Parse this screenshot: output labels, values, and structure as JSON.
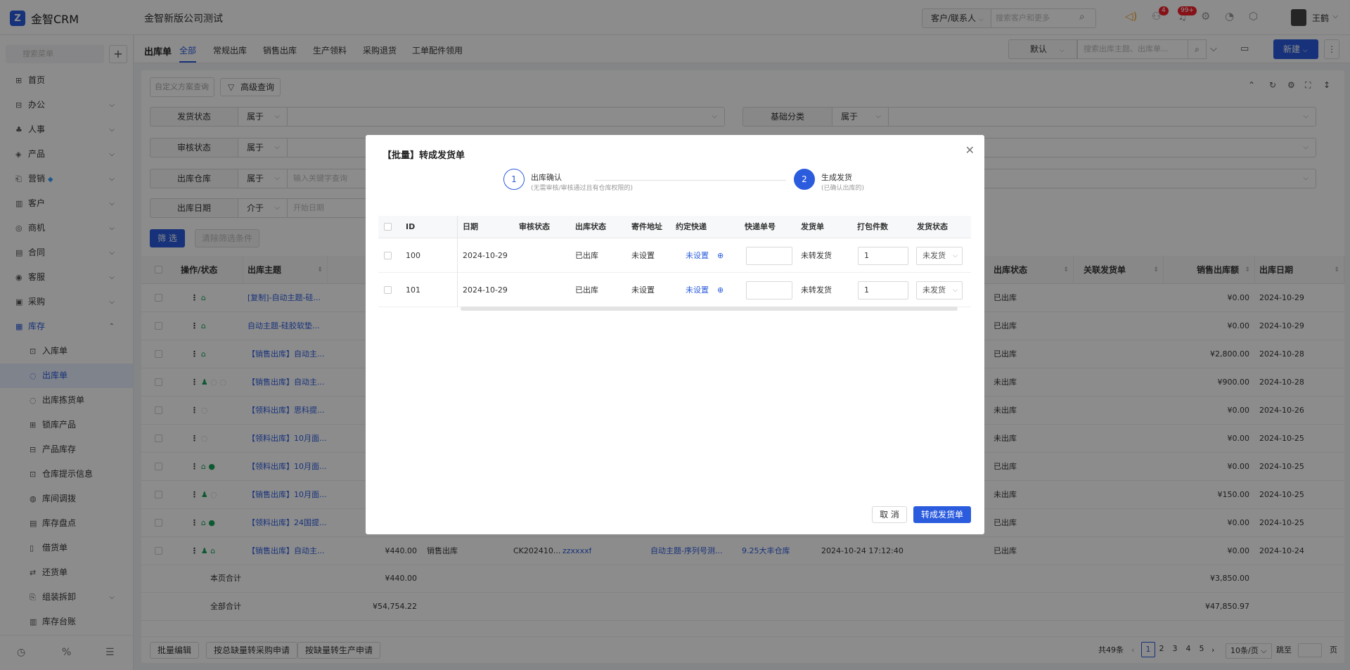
{
  "app": {
    "logo_mark": "Z",
    "logo_text": "金智CRM",
    "company": "金智新版公司测试"
  },
  "topbar": {
    "search_type": "客户/联系人",
    "search_placeholder": "搜索客户和更多",
    "notif_badge_1": "4",
    "notif_badge_2": "99+",
    "user_name": "王鹤"
  },
  "sidebar": {
    "search_placeholder": "搜索菜单",
    "add_label": "+",
    "items": [
      {
        "label": "首页",
        "icon": "home-icon"
      },
      {
        "label": "办公",
        "icon": "office-icon"
      },
      {
        "label": "人事",
        "icon": "hr-icon"
      },
      {
        "label": "产品",
        "icon": "product-icon"
      },
      {
        "label": "营销",
        "icon": "marketing-icon"
      },
      {
        "label": "客户",
        "icon": "customer-icon"
      },
      {
        "label": "商机",
        "icon": "opportunity-icon"
      },
      {
        "label": "合同",
        "icon": "contract-icon"
      },
      {
        "label": "客服",
        "icon": "service-icon"
      },
      {
        "label": "采购",
        "icon": "purchase-icon"
      },
      {
        "label": "库存",
        "icon": "inventory-icon"
      }
    ],
    "sub_items": [
      {
        "label": "入库单"
      },
      {
        "label": "出库单"
      },
      {
        "label": "出库拣货单"
      },
      {
        "label": "锁库产品"
      },
      {
        "label": "产品库存"
      },
      {
        "label": "仓库提示信息"
      },
      {
        "label": "库间调拨"
      },
      {
        "label": "库存盘点"
      },
      {
        "label": "借货单"
      },
      {
        "label": "还货单"
      },
      {
        "label": "组装拆卸"
      },
      {
        "label": "库存台账"
      }
    ]
  },
  "subbar": {
    "title": "出库单",
    "tabs": [
      "全部",
      "常规出库",
      "销售出库",
      "生产领料",
      "采购退货",
      "工单配件领用"
    ],
    "view": "默认",
    "search_placeholder": "搜索出库主题、出库单...",
    "new_label": "新建"
  },
  "filters": {
    "custom_query": "自定义方案查询",
    "advanced": "高级查询",
    "rows": [
      {
        "label": "发货状态",
        "op": "属于",
        "value": ""
      },
      {
        "label": "审核状态",
        "op": "属于",
        "value": ""
      },
      {
        "label": "出库仓库",
        "op": "属于",
        "value": "输入关键字查询"
      },
      {
        "label": "出库日期",
        "op": "介于",
        "value": "开始日期"
      }
    ],
    "extra": {
      "label": "基础分类",
      "op": "属于"
    },
    "filter_btn": "筛 选",
    "clear_btn": "清除筛选条件"
  },
  "grid": {
    "headers": {
      "ops": "操作/状态",
      "subject": "出库主题",
      "out_status": "出库状态",
      "linked": "关联发货单",
      "sale_amount": "销售出库额",
      "out_date": "出库日期"
    },
    "rows": [
      {
        "subject": "[复制]-自动主题-硅...",
        "status": "已出库",
        "amount": "¥0.00",
        "date": "2024-10-29"
      },
      {
        "subject": "自动主题-硅胶软垫...",
        "status": "已出库",
        "amount": "¥0.00",
        "date": "2024-10-29"
      },
      {
        "subject": "【销售出库】自动主...",
        "status": "已出库",
        "amount": "¥2,800.00",
        "date": "2024-10-28"
      },
      {
        "subject": "【销售出库】自动主...",
        "status": "未出库",
        "amount": "¥900.00",
        "date": "2024-10-28"
      },
      {
        "subject": "【领料出库】思科提...",
        "status": "未出库",
        "amount": "¥0.00",
        "date": "2024-10-26"
      },
      {
        "subject": "【领料出库】10月面...",
        "status": "未出库",
        "amount": "¥0.00",
        "date": "2024-10-25"
      },
      {
        "subject": "【领料出库】10月面...",
        "status": "已出库",
        "amount": "¥0.00",
        "date": "2024-10-25"
      },
      {
        "subject": "【销售出库】10月面...",
        "status": "未出库",
        "amount": "¥150.00",
        "date": "2024-10-25"
      },
      {
        "subject": "【领料出库】24国提...",
        "status": "已出库",
        "amount": "¥0.00",
        "date": "2024-10-25"
      },
      {
        "subject": "【销售出库】自动主...",
        "status": "已出库",
        "amount": "¥0.00",
        "date": "2024-10-24"
      }
    ],
    "last_row_extra": {
      "total": "¥440.00",
      "type": "销售出库",
      "code": "CK202410...",
      "customer": "zzxxxxf",
      "subject2": "自动主题-序列号测...",
      "warehouse": "9.25大丰仓库",
      "time": "2024-10-24 17:12:40"
    },
    "page_total_label": "本页合计",
    "page_total_value": "¥440.00",
    "page_total_sale": "¥3,850.00",
    "all_total_label": "全部合计",
    "all_total_value": "¥54,754.22",
    "all_total_sale": "¥47,850.97"
  },
  "footer": {
    "batch_edit": "批量编辑",
    "to_purchase": "按总缺量转采购申请",
    "to_production": "按缺量转生产申请",
    "total": "共49条",
    "pages": [
      "1",
      "2",
      "3",
      "4",
      "5"
    ],
    "page_size": "10条/页",
    "goto": "跳至",
    "page_unit": "页"
  },
  "modal": {
    "title": "【批量】转成发货单",
    "step1_num": "1",
    "step1_title": "出库确认",
    "step1_desc": "(无需审核/审核通过且有仓库权限的)",
    "step2_num": "2",
    "step2_title": "生成发货",
    "step2_desc": "(已确认出库的)",
    "headers": [
      "ID",
      "日期",
      "审核状态",
      "出库状态",
      "寄件地址",
      "约定快递",
      "快递单号",
      "发货单",
      "打包件数",
      "发货状态"
    ],
    "rows": [
      {
        "id": "100",
        "date": "2024-10-29",
        "audit": "",
        "out_status": "已出库",
        "address": "未设置",
        "express": "未设置",
        "tracking": "",
        "delivery": "未转发货",
        "packages": "1",
        "ship_status": "未发货"
      },
      {
        "id": "101",
        "date": "2024-10-29",
        "audit": "",
        "out_status": "已出库",
        "address": "未设置",
        "express": "未设置",
        "tracking": "",
        "delivery": "未转发货",
        "packages": "1",
        "ship_status": "未发货"
      }
    ],
    "cancel": "取 消",
    "confirm": "转成发货单"
  },
  "colors": {
    "accent": "#2b5cde",
    "success": "#19a35a",
    "badge": "#f5222d"
  }
}
